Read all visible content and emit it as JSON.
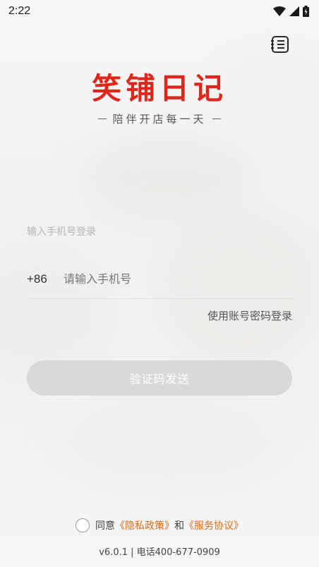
{
  "status_bar": {
    "time": "2:22"
  },
  "header": {
    "menu_icon": "list-menu-icon"
  },
  "brand": {
    "logo_text": "笑铺日记",
    "slogan": "陪伴开店每一天",
    "accent_color": "#e0251b"
  },
  "login": {
    "hint": "输入手机号登录",
    "country_code": "+86",
    "phone_placeholder": "请输入手机号",
    "password_login_link": "使用账号密码登录",
    "send_code_button": "验证码发送"
  },
  "agreement": {
    "prefix": "同意",
    "privacy_link": "《隐私政策》",
    "and": "和",
    "service_link": "《服务协议》",
    "link_color": "#e06a17"
  },
  "footer": {
    "version_info": "v6.0.1 | 电话400-677-0909"
  }
}
